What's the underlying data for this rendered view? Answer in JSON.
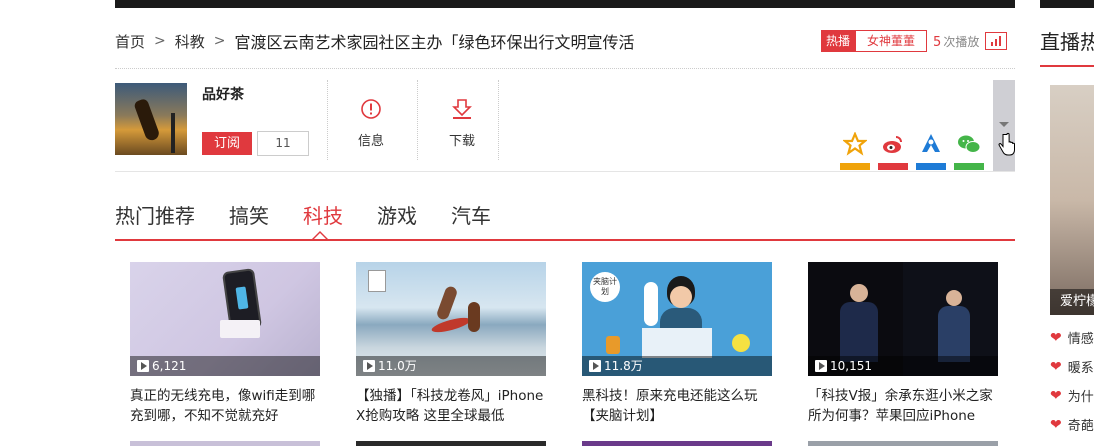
{
  "breadcrumb": {
    "home": "首页",
    "category": "科教",
    "title": "官渡区云南艺术家园社区主办「绿色环保出行文明宣传活"
  },
  "hot": {
    "tag": "热播",
    "user": "女神董董",
    "count": "5",
    "count_suffix": "次播放"
  },
  "channel": {
    "name": "品好茶",
    "subscribe_label": "订阅",
    "subscribe_count": "11"
  },
  "actions": {
    "info_label": "信息",
    "download_label": "下载"
  },
  "share": [
    {
      "icon": "qzone-star-icon",
      "color": "#f0a30a"
    },
    {
      "icon": "weibo-icon",
      "color": "#e0393e"
    },
    {
      "icon": "tencent-weibo-icon",
      "color": "#1e7bd6"
    },
    {
      "icon": "wechat-icon",
      "color": "#44b549"
    }
  ],
  "tabs": [
    "热门推荐",
    "搞笑",
    "科技",
    "游戏",
    "汽车"
  ],
  "active_tab": "科技",
  "accent_color": "#e0393e",
  "videos": [
    {
      "plays": "6,121",
      "caption": "真正的无线充电，像wifi走到哪充到哪，不知不觉就充好"
    },
    {
      "plays": "11.0万",
      "caption": "【独播】「科技龙卷风」iPhone X抢购攻略 这里全球最低"
    },
    {
      "plays": "11.8万",
      "caption": "黑科技！原来充电还能这么玩【夹脑计划】"
    },
    {
      "plays": "10,151",
      "caption": "「科技V报」余承东逛小米之家所为何事？苹果回应iPhone"
    }
  ],
  "video3_badge": "夹脑计划",
  "right": {
    "title": "直播热",
    "image_label": "爱柠檬",
    "items": [
      "情感",
      "暖系",
      "为什",
      "奇葩"
    ]
  }
}
